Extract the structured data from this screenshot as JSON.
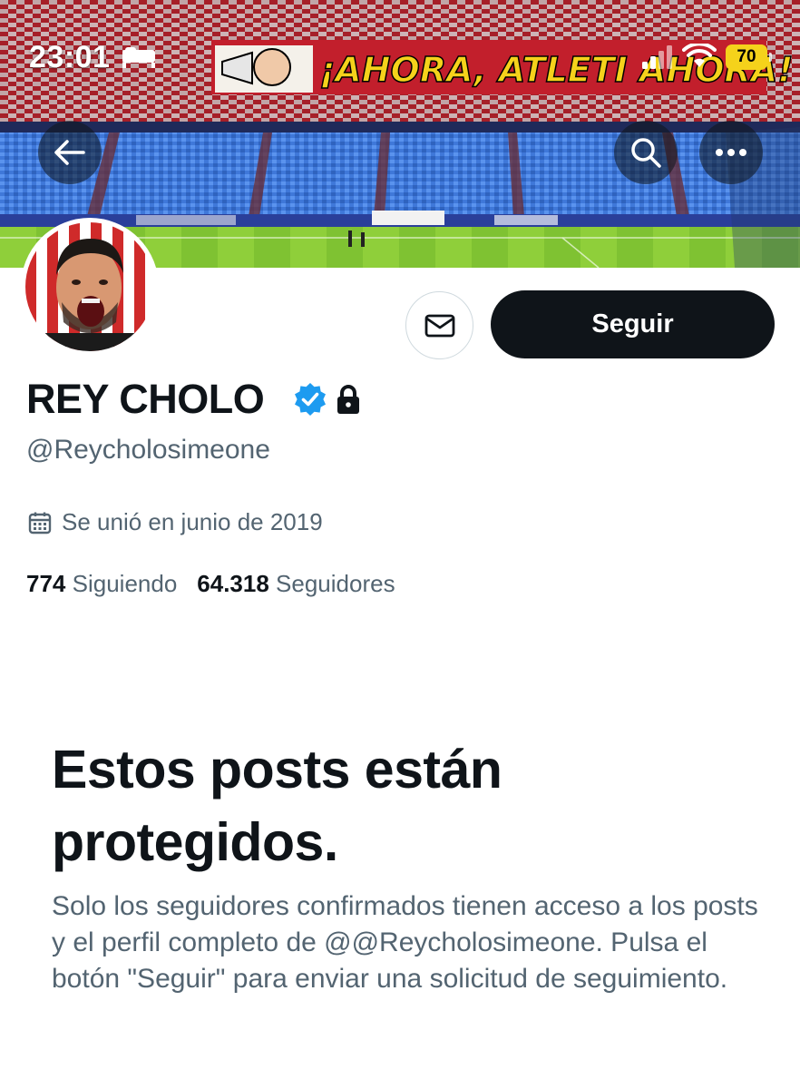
{
  "status_bar": {
    "time": "23:01",
    "battery": "70",
    "icons": [
      "sleep-icon",
      "signal-icon",
      "wifi-icon",
      "battery-icon"
    ]
  },
  "banner": {
    "text": "¡AHORA, ATLETI AHORA!"
  },
  "nav": {
    "icons": [
      "back-arrow-icon",
      "search-icon",
      "more-icon"
    ]
  },
  "actions": {
    "follow_label": "Seguir",
    "message_icon": "envelope-icon"
  },
  "profile": {
    "name": "REY CHOLO",
    "handle": "@Reycholosimeone",
    "join_date": "Se unió en junio de 2019",
    "following_count": "774",
    "following_label": "Siguiendo",
    "followers_count": "64.318",
    "followers_label": "Seguidores",
    "verified_color": "#1d9bf0"
  },
  "protected": {
    "title": "Estos posts están protegidos.",
    "body": "Solo los seguidores confirmados tienen acceso a los posts y el perfil completo de @@Reycholosimeone. Pulsa el botón \"Seguir\" para enviar una solicitud de seguimiento."
  }
}
